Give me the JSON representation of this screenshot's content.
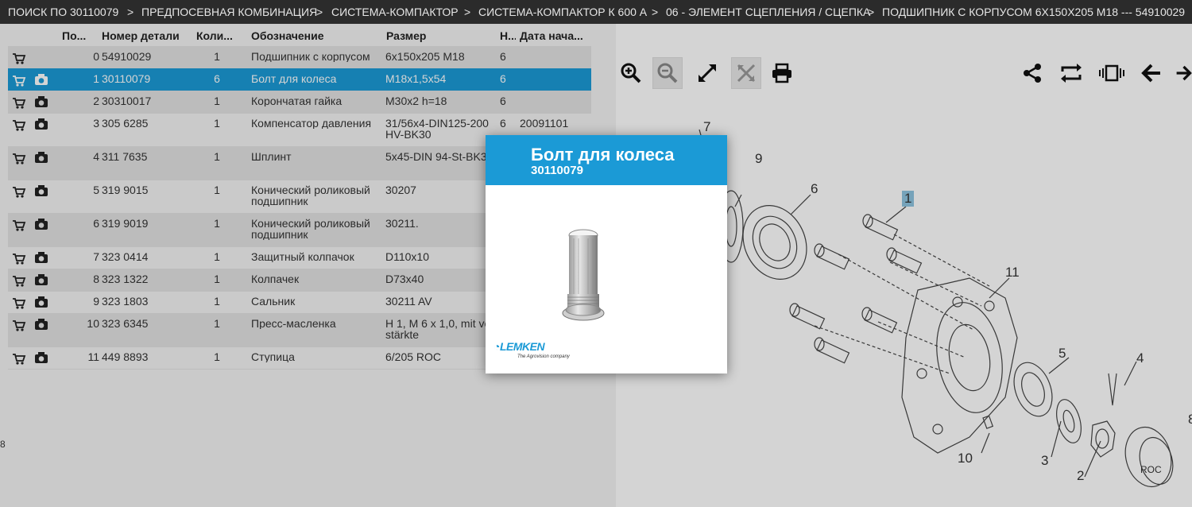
{
  "breadcrumb": {
    "separator": ">",
    "items": [
      "ПОИСК ПО 30110079",
      "ПРЕДПОСЕВНАЯ КОМБИНАЦИЯ",
      "СИСТЕМА-КОМПАКТОР",
      "СИСТЕМА-КОМПАКТОР К 600 А",
      "06 - ЭЛЕМЕНТ СЦЕПЛЕНИЯ / СЦЕПКА",
      "ПОДШИПНИК С КОРПУСОМ 6X150X205 M18 --- 54910029"
    ]
  },
  "table": {
    "columns": [
      "По...",
      "Номер детали",
      "Коли...",
      "Обозначение",
      "Размер",
      "Н...",
      "Дата нача..."
    ],
    "rows": [
      {
        "pos": "0",
        "part": "54910029",
        "qty": "1",
        "desc": "Подшипник с корпусом",
        "size": "6x150x205 M18",
        "n": "6",
        "date": ""
      },
      {
        "pos": "1",
        "part": "30110079",
        "qty": "6",
        "desc": "Болт для колеса",
        "size": "M18x1,5x54",
        "n": "6",
        "date": ""
      },
      {
        "pos": "2",
        "part": "30310017",
        "qty": "1",
        "desc": "Корончатая гайка",
        "size": "M30x2 h=18",
        "n": "6",
        "date": ""
      },
      {
        "pos": "3",
        "part": "305 6285",
        "qty": "1",
        "desc": "Компенсатор давления",
        "size": "31/56x4-DIN125-200HV-BK30",
        "n": "6",
        "date": "20091101"
      },
      {
        "pos": "4",
        "part": "311 7635",
        "qty": "1",
        "desc": "Шплинт",
        "size": "5x45-DIN 94-St-BK30",
        "n": "",
        "date": ""
      },
      {
        "pos": "5",
        "part": "319 9015",
        "qty": "1",
        "desc": "Конический роликовый подшипник",
        "size": "30207",
        "n": "",
        "date": ""
      },
      {
        "pos": "6",
        "part": "319 9019",
        "qty": "1",
        "desc": "Конический роликовый подшипник",
        "size": "30211.",
        "n": "",
        "date": ""
      },
      {
        "pos": "7",
        "part": "323 0414",
        "qty": "1",
        "desc": "Защитный колпачок",
        "size": "D110x10",
        "n": "",
        "date": ""
      },
      {
        "pos": "8",
        "part": "323 1322",
        "qty": "1",
        "desc": "Колпачек",
        "size": "D73x40",
        "n": "",
        "date": ""
      },
      {
        "pos": "9",
        "part": "323 1803",
        "qty": "1",
        "desc": "Сальник",
        "size": "30211 AV",
        "n": "",
        "date": ""
      },
      {
        "pos": "10",
        "part": "323 6345",
        "qty": "1",
        "desc": "Пресс-масленка",
        "size": "H 1, M 6 x 1,0, mit verstärkte",
        "n": "",
        "date": ""
      },
      {
        "pos": "11",
        "part": "449 8893",
        "qty": "1",
        "desc": "Ступица",
        "size": "6/205 ROC",
        "n": "",
        "date": ""
      }
    ],
    "selected_row": "1",
    "icons": {
      "cart": "cart-icon",
      "camera": "camera-icon"
    }
  },
  "toolbar": {
    "left": [
      "zoom-in-icon",
      "zoom-out-icon",
      "expand-icon",
      "fit-icon",
      "print-icon"
    ],
    "right": [
      "share-icon",
      "swap-icon",
      "frames-icon",
      "arrow-left-icon",
      "arrow-right-icon"
    ]
  },
  "diagram": {
    "callouts": [
      "7",
      "9",
      "6",
      "1",
      "11",
      "5",
      "4",
      "10",
      "3",
      "2",
      "8"
    ],
    "highlighted": "1",
    "cap_text": "ROC"
  },
  "modal": {
    "title": "Болт для колеса",
    "part_number": "30110079",
    "brand": "LEMKEN",
    "brand_tagline": "The Agrovision company"
  },
  "colors": {
    "accent": "#1b9ad6",
    "breadcrumb_bg": "#2b2b2b",
    "row_alt": "#e3e3e3"
  },
  "edge_glyph": "8"
}
